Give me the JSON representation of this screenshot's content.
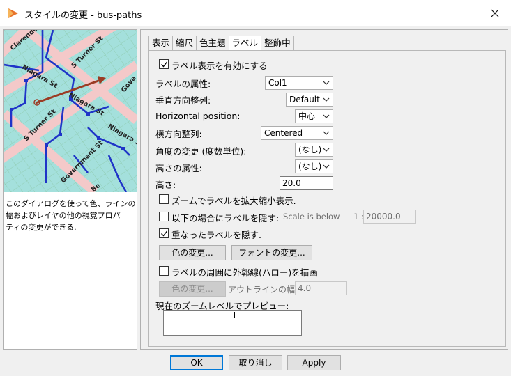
{
  "window": {
    "title": "スタイルの変更 - bus-paths"
  },
  "icons": {
    "app": "app-logo-icon",
    "close": "close-icon",
    "dropdown": "chevron-down-icon",
    "check": "checkmark-icon"
  },
  "preview_map": {
    "street_labels": [
      "Clarendon",
      "Niagara St",
      "S Turner St",
      "Niagara St",
      "S Turner St",
      "Niagara St",
      "Government St",
      "Gove",
      "Be"
    ]
  },
  "help_text": [
    "このダイアログを使って色、ラインの",
    "幅およびレイヤの他の視覚プロパ",
    "ティの変更ができる."
  ],
  "tabs": [
    {
      "label": "表示",
      "active": false
    },
    {
      "label": "縮尺",
      "active": false
    },
    {
      "label": "色主題",
      "active": false
    },
    {
      "label": "ラベル",
      "active": true
    },
    {
      "label": "整飾中",
      "active": false
    }
  ],
  "label_tab": {
    "enable_labels": {
      "label": "ラベル表示を有効にする",
      "checked": true
    },
    "label_attribute": {
      "label": "ラベルの属性:",
      "value": "Col1"
    },
    "vertical_align": {
      "label": "垂直方向整列:",
      "value": "Default"
    },
    "horizontal_position": {
      "label": "Horizontal position:",
      "value": "中心"
    },
    "horizontal_align": {
      "label": "横方向整列:",
      "value": "Centered"
    },
    "angle": {
      "label": "角度の変更 (度数単位):",
      "value": "(なし)"
    },
    "height_attribute": {
      "label": "高さの属性:",
      "value": "(なし)"
    },
    "height": {
      "label": "高さ:",
      "value": "20.0"
    },
    "zoom_scale": {
      "label": "ズームでラベルを拡大縮小表示.",
      "checked": false
    },
    "hide_labels": {
      "label": "以下の場合にラベルを隠す:",
      "checked": false,
      "condition": "Scale is below",
      "scale_prefix": "1 :",
      "scale_value": "20000.0"
    },
    "hide_overlap": {
      "label": "重なったラベルを隠す.",
      "checked": true
    },
    "color_button": "色の変更...",
    "font_button": "フォントの変更...",
    "halo": {
      "label": "ラベルの周囲に外郭線(ハロー)を描画",
      "checked": false
    },
    "halo_color_button": "色の変更...",
    "outline_width": {
      "label": "アウトラインの幅:",
      "value": "4.0"
    },
    "preview_label": "現在のズームレベルでプレビュー:"
  },
  "footer": {
    "ok": "OK",
    "cancel": "取り消し",
    "apply": "Apply"
  }
}
